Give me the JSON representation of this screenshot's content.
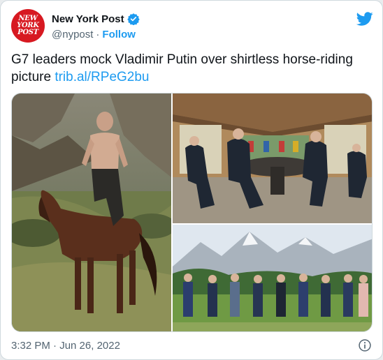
{
  "header": {
    "avatar_lines": [
      "NEW",
      "YORK",
      "POST"
    ],
    "display_name": "New York Post",
    "handle": "@nypost",
    "separator": "·",
    "follow_label": "Follow"
  },
  "tweet": {
    "text": "G7 leaders mock Vladimir Putin over shirtless horse-riding picture ",
    "link": "trib.al/RPeG2bu"
  },
  "footer": {
    "timestamp": "3:32 PM · Jun 26, 2022"
  },
  "colors": {
    "accent": "#1d9bf0",
    "brand": "#d71921",
    "text": "#0f1419",
    "muted": "#536471"
  }
}
